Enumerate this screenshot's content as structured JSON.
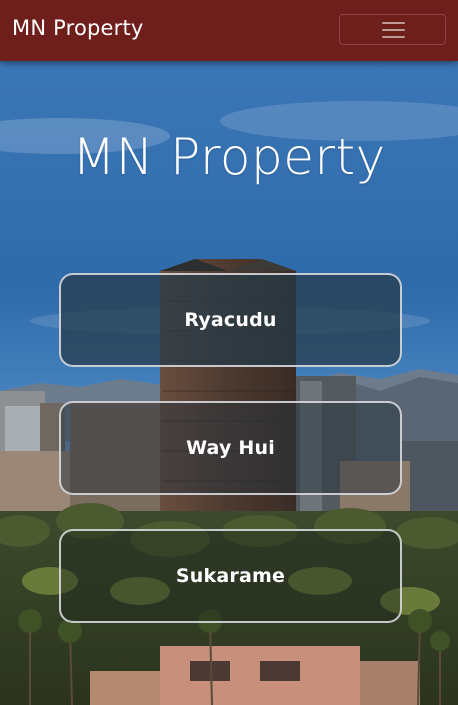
{
  "navbar": {
    "brand": "MN Property",
    "toggle_icon": "hamburger-menu-icon",
    "background_color": "#6e1e1b"
  },
  "hero": {
    "title": "MN Property",
    "background_image": "city-skyline-photo"
  },
  "properties": [
    {
      "label": "Ryacudu"
    },
    {
      "label": "Way Hui"
    },
    {
      "label": "Sukarame"
    }
  ],
  "colors": {
    "button_border": "#e1e4e8",
    "text": "#ffffff"
  }
}
